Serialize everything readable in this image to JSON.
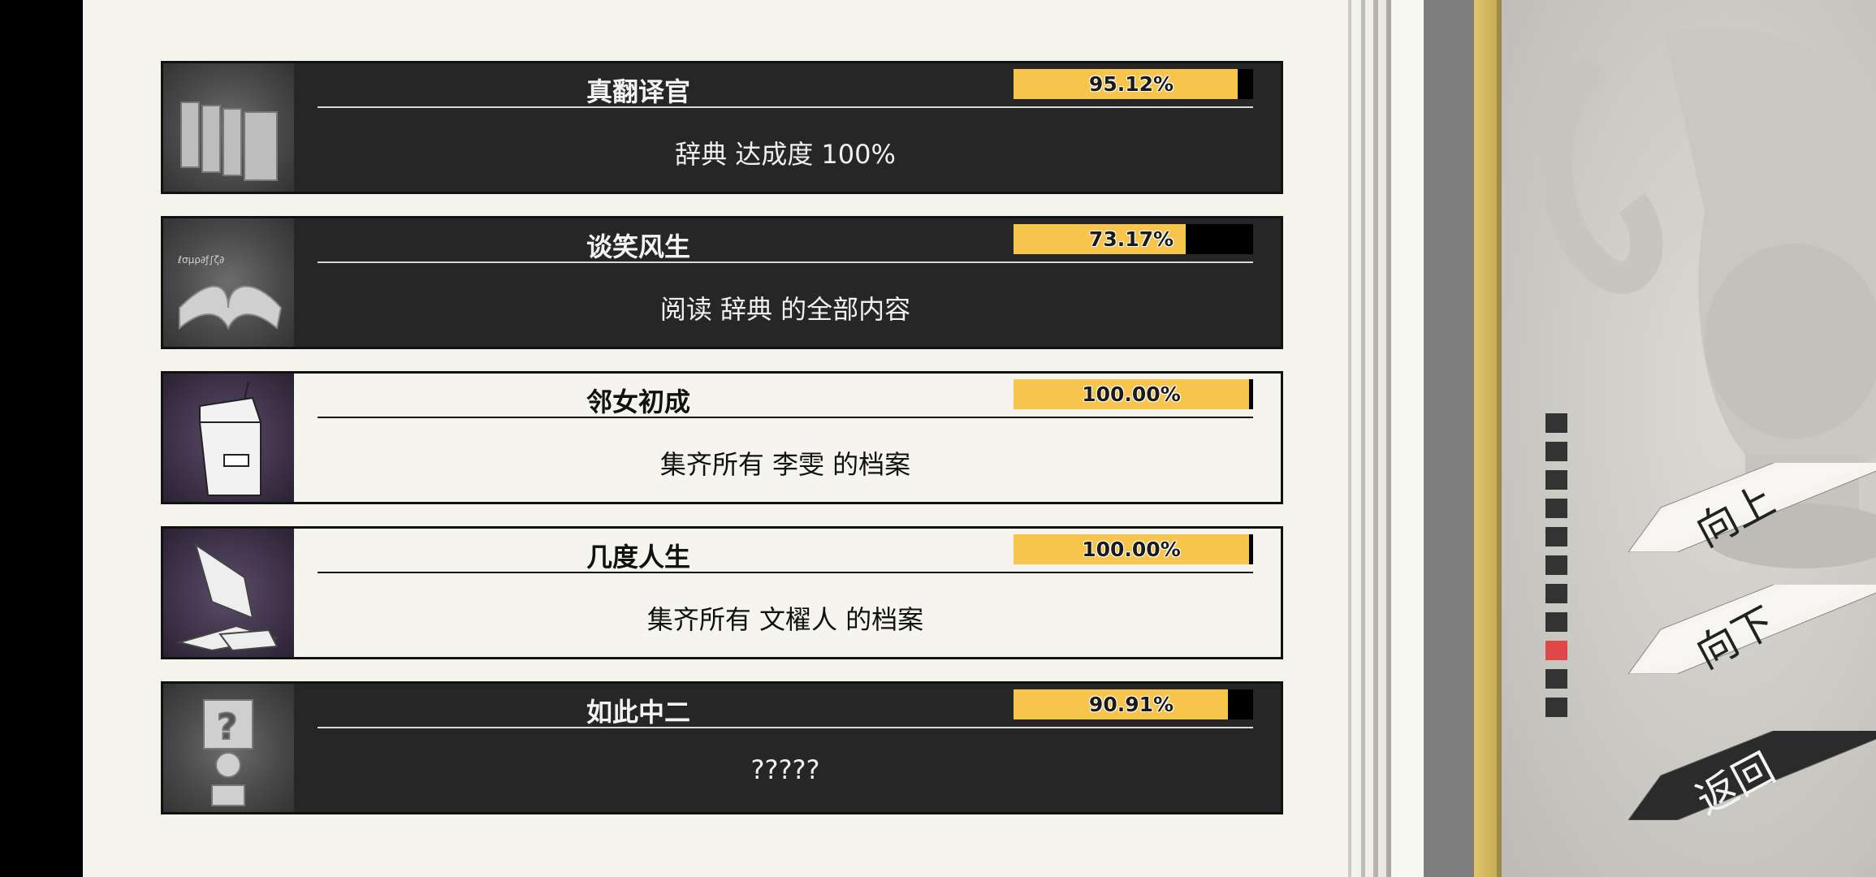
{
  "achievements": [
    {
      "title": "真翻译官",
      "progress_text": "95.12%",
      "progress": 95.12,
      "description": "辞典 达成度 100%",
      "theme": "dark",
      "icon": "books-icon"
    },
    {
      "title": "谈笑风生",
      "progress_text": "73.17%",
      "progress": 73.17,
      "description": "阅读 辞典 的全部内容",
      "theme": "dark",
      "icon": "open-book-icon"
    },
    {
      "title": "邻女初成",
      "progress_text": "100.00%",
      "progress": 100.0,
      "description": "集齐所有 李雯 的档案",
      "theme": "light",
      "icon": "milk-carton-icon"
    },
    {
      "title": "几度人生",
      "progress_text": "100.00%",
      "progress": 100.0,
      "description": "集齐所有 文櫂人 的档案",
      "theme": "light",
      "icon": "scattered-papers-icon"
    },
    {
      "title": "如此中二",
      "progress_text": "90.91%",
      "progress": 90.91,
      "description": "?????",
      "theme": "dark",
      "icon": "mystery-figure-icon"
    }
  ],
  "pager": {
    "total": 11,
    "active_index": 8
  },
  "nav": {
    "up_label": "向上",
    "down_label": "向下",
    "back_label": "返回"
  },
  "colors": {
    "progress_fill": "#f7c44c",
    "active_page": "#e04848",
    "gold_stripe": "#d9bd62"
  }
}
